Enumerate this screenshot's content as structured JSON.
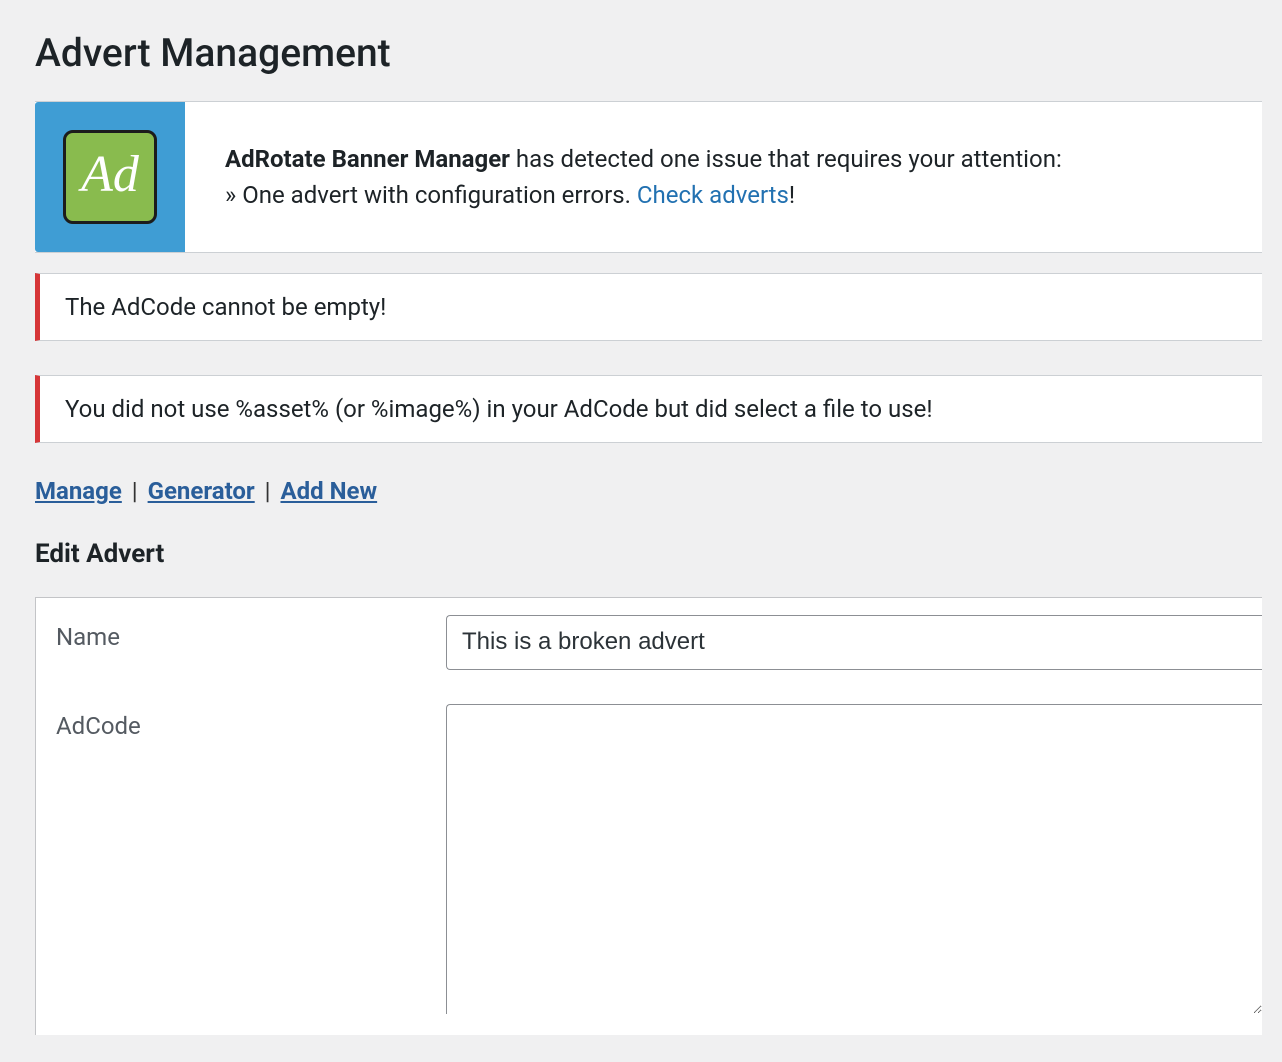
{
  "page_title": "Advert Management",
  "banner": {
    "icon_text": "Ad",
    "strong": "AdRotate Banner Manager",
    "line1_rest": " has detected one issue that requires your attention:",
    "line2_prefix": "» One advert with configuration errors. ",
    "link_text": "Check adverts",
    "line2_suffix": "!"
  },
  "errors": [
    "The AdCode cannot be empty!",
    "You did not use %asset% (or %image%) in your AdCode but did select a file to use!"
  ],
  "subnav": {
    "manage": "Manage",
    "generator": "Generator",
    "add_new": "Add New"
  },
  "section_title": "Edit Advert",
  "form": {
    "name_label": "Name",
    "name_value": "This is a broken advert",
    "adcode_label": "AdCode",
    "adcode_value": ""
  }
}
